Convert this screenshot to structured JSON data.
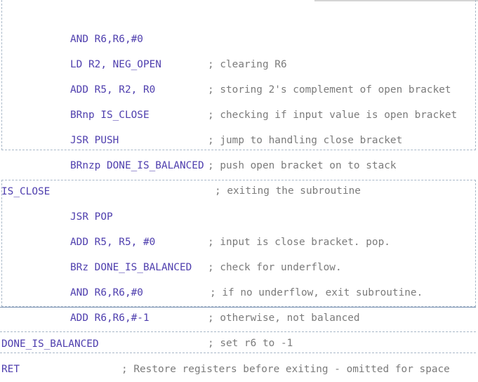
{
  "block1": [
    {
      "code": "AND R6,R6,#0",
      "comment": "; clearing R6"
    },
    {
      "code": "LD R2, NEG_OPEN",
      "comment": "; storing 2's complement of open bracket"
    },
    {
      "code": "ADD R5, R2, R0",
      "comment": "; checking if input value is open bracket"
    },
    {
      "code": "BRnp IS_CLOSE",
      "comment": "; jump to handling close bracket"
    },
    {
      "code": "JSR PUSH",
      "comment": "; push open bracket on to stack"
    },
    {
      "code": "BRnzp DONE_IS_BALANCED",
      "comment": "; exiting the subroutine"
    }
  ],
  "label_is_close": "IS_CLOSE",
  "block2": [
    {
      "code": "JSR POP",
      "comment": "; input is close bracket. pop."
    },
    {
      "code": "ADD R5, R5, #0",
      "comment": "; check for underflow."
    },
    {
      "code": "BRz DONE_IS_BALANCED",
      "comment": "; if no underflow, exit subroutine."
    },
    {
      "code": "AND R6,R6,#0",
      "comment": "; otherwise, not balanced"
    },
    {
      "code": "ADD R6,R6,#-1",
      "comment": "; set r6 to -1"
    }
  ],
  "done_line": {
    "code": "DONE_IS_BALANCED",
    "comment": "; Restore registers before exiting - omitted for space"
  },
  "ret_line": {
    "code": "RET"
  }
}
